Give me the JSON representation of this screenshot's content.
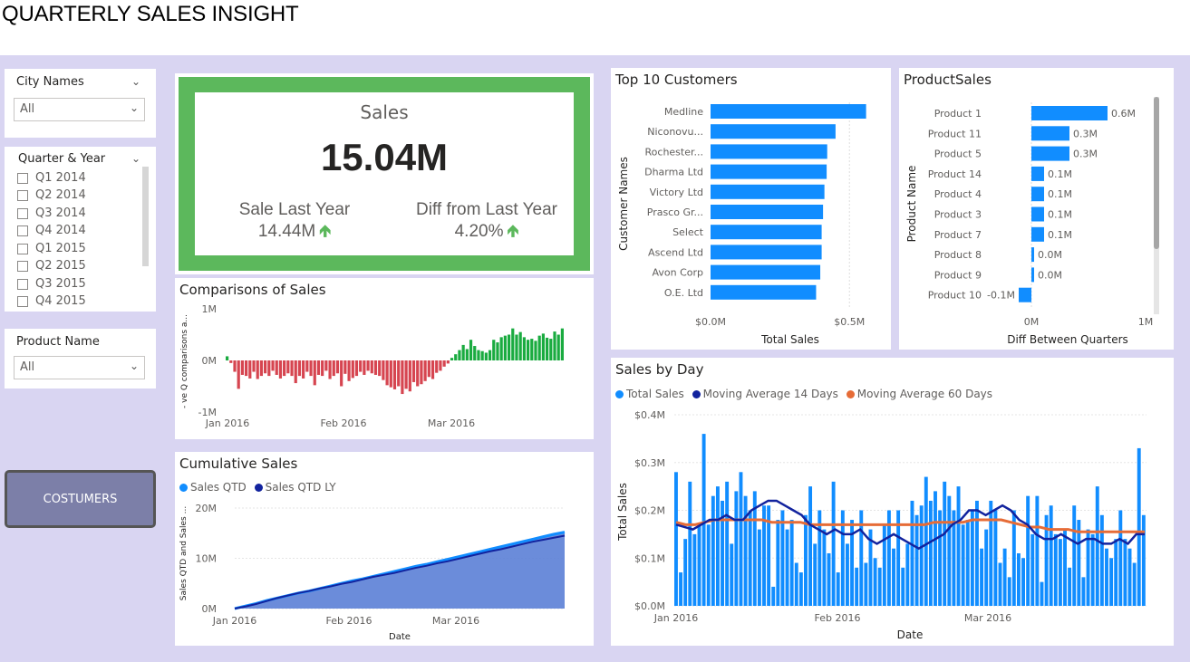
{
  "page": {
    "title": "QUARTERLY SALES INSIGHT"
  },
  "slicers": {
    "city": {
      "label": "City Names",
      "value": "All"
    },
    "quarter": {
      "label": "Quarter & Year",
      "items": [
        "Q1 2014",
        "Q2 2014",
        "Q3 2014",
        "Q4 2014",
        "Q1 2015",
        "Q2 2015",
        "Q3 2015",
        "Q4 2015"
      ]
    },
    "product": {
      "label": "Product Name",
      "value": "All"
    }
  },
  "button": {
    "label": "COSTUMERS"
  },
  "kpi": {
    "title": "Sales",
    "value": "15.04M",
    "last_year_label": "Sale Last Year",
    "last_year_value": "14.44M",
    "diff_label": "Diff from Last Year",
    "diff_value": "4.20%"
  },
  "colors": {
    "accent_blue": "#118dff",
    "navy": "#12239e",
    "orange": "#e66c37",
    "green": "#1aab40",
    "red": "#d64550",
    "kpi_border": "#5cb85c"
  },
  "chart_data": [
    {
      "id": "top10",
      "type": "bar",
      "title": "Top 10 Customers",
      "xlabel": "Total Sales",
      "ylabel": "Customer Names",
      "categories": [
        "Medline",
        "Niconovu...",
        "Rochester...",
        "Dharma Ltd",
        "Victory Ltd",
        "Prasco Gr...",
        "Select",
        "Ascend Ltd",
        "Avon Corp",
        "O.E. Ltd"
      ],
      "values": [
        0.56,
        0.45,
        0.42,
        0.418,
        0.41,
        0.405,
        0.4,
        0.4,
        0.395,
        0.38
      ],
      "xticks": [
        "$0.0M",
        "$0.5M"
      ],
      "xlim": [
        0,
        0.62
      ]
    },
    {
      "id": "product",
      "type": "bar",
      "title": "ProductSales",
      "xlabel": "Diff Between Quarters",
      "ylabel": "Product Name",
      "categories": [
        "Product 1",
        "Product 11",
        "Product 5",
        "Product 14",
        "Product 4",
        "Product 3",
        "Product 7",
        "Product 8",
        "Product 9",
        "Product 10"
      ],
      "values": [
        0.6,
        0.3,
        0.3,
        0.1,
        0.1,
        0.1,
        0.1,
        0.0,
        0.0,
        -0.1
      ],
      "data_labels": [
        "0.6M",
        "0.3M",
        "0.3M",
        "0.1M",
        "0.1M",
        "0.1M",
        "0.1M",
        "0.0M",
        "0.0M",
        "-0.1M"
      ],
      "xticks": [
        "0M",
        "1M"
      ],
      "xlim": [
        -0.2,
        1.0
      ]
    },
    {
      "id": "comparisons",
      "type": "bar",
      "title": "Comparisons of Sales",
      "ylabel": "- ve Q comparisons a...",
      "yticks": [
        "1M",
        "0M",
        "-1M"
      ],
      "ylim": [
        -1,
        1
      ],
      "xticks": [
        "Jan 2016",
        "Feb 2016",
        "Mar 2016"
      ],
      "values": [
        0.08,
        -0.05,
        -0.22,
        -0.55,
        -0.28,
        -0.3,
        -0.35,
        -0.22,
        -0.36,
        -0.3,
        -0.25,
        -0.3,
        -0.2,
        -0.28,
        -0.35,
        -0.3,
        -0.25,
        -0.3,
        -0.44,
        -0.3,
        -0.35,
        -0.22,
        -0.3,
        -0.48,
        -0.28,
        -0.3,
        -0.2,
        -0.36,
        -0.3,
        -0.25,
        -0.5,
        -0.26,
        -0.4,
        -0.34,
        -0.3,
        -0.22,
        -0.28,
        -0.2,
        -0.25,
        -0.28,
        -0.3,
        -0.38,
        -0.48,
        -0.52,
        -0.56,
        -0.5,
        -0.65,
        -0.55,
        -0.6,
        -0.42,
        -0.5,
        -0.46,
        -0.4,
        -0.32,
        -0.36,
        -0.24,
        -0.2,
        -0.12,
        -0.06,
        0.05,
        0.12,
        0.2,
        0.3,
        0.22,
        0.4,
        0.28,
        0.2,
        0.18,
        0.15,
        0.2,
        0.4,
        0.35,
        0.45,
        0.48,
        0.5,
        0.62,
        0.5,
        0.55,
        0.45,
        0.4,
        0.42,
        0.38,
        0.48,
        0.52,
        0.44,
        0.42,
        0.56,
        0.5,
        0.62
      ]
    },
    {
      "id": "cumulative",
      "type": "area",
      "title": "Cumulative Sales",
      "xlabel": "Date",
      "ylabel": "Sales QTD and Sales ...",
      "series_names": [
        "Sales QTD",
        "Sales QTD LY"
      ],
      "yticks": [
        "20M",
        "10M",
        "0M"
      ],
      "ylim": [
        0,
        20
      ],
      "xticks": [
        "Jan 2016",
        "Feb 2016",
        "Mar 2016"
      ],
      "qtd": [
        0,
        0.5,
        1.0,
        1.6,
        2.1,
        2.6,
        3.1,
        3.5,
        4.0,
        4.5,
        5.0,
        5.5,
        5.9,
        6.4,
        6.9,
        7.4,
        7.9,
        8.4,
        8.8,
        9.3,
        9.8,
        10.3,
        10.8,
        11.3,
        11.8,
        12.3,
        12.8,
        13.3,
        13.8,
        14.3,
        14.8,
        15.2
      ],
      "ly": [
        0,
        0.4,
        0.9,
        1.5,
        2.1,
        2.6,
        3.1,
        3.5,
        4.0,
        4.4,
        4.9,
        5.3,
        5.8,
        6.3,
        6.7,
        7.1,
        7.6,
        8.1,
        8.5,
        9.0,
        9.4,
        9.9,
        10.4,
        10.9,
        11.4,
        11.8,
        12.3,
        12.8,
        13.3,
        13.7,
        14.1,
        14.5
      ]
    },
    {
      "id": "daily",
      "type": "bar",
      "title": "Sales by Day",
      "xlabel": "Date",
      "ylabel": "Total Sales",
      "series_names": [
        "Total Sales",
        "Moving Average 14 Days",
        "Moving Average 60 Days"
      ],
      "yticks": [
        "$0.4M",
        "$0.3M",
        "$0.2M",
        "$0.1M",
        "$0.0M"
      ],
      "ylim": [
        0,
        0.4
      ],
      "xticks": [
        "Jan 2016",
        "Feb 2016",
        "Mar 2016"
      ],
      "values": [
        0.28,
        0.07,
        0.14,
        0.26,
        0.15,
        0.17,
        0.36,
        0.17,
        0.23,
        0.25,
        0.22,
        0.26,
        0.13,
        0.24,
        0.28,
        0.23,
        0.2,
        0.24,
        0.16,
        0.21,
        0.21,
        0.04,
        0.18,
        0.2,
        0.16,
        0.18,
        0.09,
        0.07,
        0.19,
        0.25,
        0.13,
        0.2,
        0.16,
        0.11,
        0.26,
        0.07,
        0.2,
        0.13,
        0.18,
        0.08,
        0.2,
        0.09,
        0.16,
        0.1,
        0.08,
        0.17,
        0.2,
        0.12,
        0.2,
        0.08,
        0.13,
        0.22,
        0.19,
        0.21,
        0.27,
        0.22,
        0.24,
        0.2,
        0.26,
        0.23,
        0.2,
        0.25,
        0.17,
        0.18,
        0.2,
        0.22,
        0.12,
        0.16,
        0.22,
        0.2,
        0.09,
        0.12,
        0.06,
        0.2,
        0.11,
        0.1,
        0.23,
        0.15,
        0.23,
        0.05,
        0.19,
        0.21,
        0.15,
        0.14,
        0.16,
        0.08,
        0.21,
        0.18,
        0.06,
        0.16,
        0.15,
        0.25,
        0.19,
        0.12,
        0.1,
        0.14,
        0.2,
        0.14,
        0.12,
        0.09,
        0.33,
        0.19
      ],
      "ma14": [
        0.17,
        0.165,
        0.16,
        0.17,
        0.18,
        0.18,
        0.19,
        0.18,
        0.18,
        0.2,
        0.21,
        0.22,
        0.22,
        0.21,
        0.2,
        0.19,
        0.17,
        0.16,
        0.15,
        0.16,
        0.15,
        0.15,
        0.16,
        0.14,
        0.13,
        0.14,
        0.15,
        0.14,
        0.13,
        0.12,
        0.13,
        0.14,
        0.15,
        0.17,
        0.18,
        0.2,
        0.2,
        0.19,
        0.2,
        0.21,
        0.2,
        0.18,
        0.17,
        0.15,
        0.14,
        0.14,
        0.15,
        0.14,
        0.13,
        0.14,
        0.14,
        0.13,
        0.13,
        0.14,
        0.13,
        0.15,
        0.15
      ],
      "ma60": [
        0.175,
        0.17,
        0.17,
        0.175,
        0.18,
        0.18,
        0.18,
        0.18,
        0.18,
        0.18,
        0.175,
        0.175,
        0.175,
        0.175,
        0.17,
        0.17,
        0.17,
        0.17,
        0.17,
        0.17,
        0.17,
        0.17,
        0.17,
        0.17,
        0.17,
        0.17,
        0.17,
        0.175,
        0.175,
        0.175,
        0.175,
        0.18,
        0.18,
        0.18,
        0.18,
        0.175,
        0.17,
        0.165,
        0.165,
        0.16,
        0.16,
        0.16,
        0.155,
        0.155,
        0.155,
        0.155,
        0.155,
        0.155,
        0.155,
        0.155
      ]
    }
  ]
}
